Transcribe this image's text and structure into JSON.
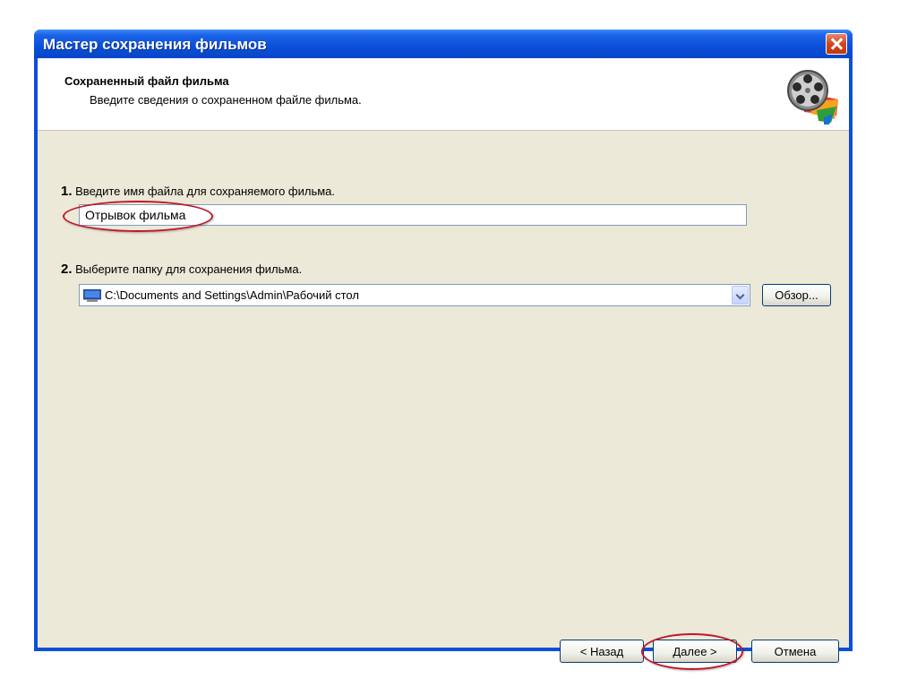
{
  "window": {
    "title": "Мастер сохранения фильмов"
  },
  "header": {
    "title": "Сохраненный файл фильма",
    "subtitle": "Введите сведения о сохраненном файле фильма.",
    "icon": "film-reel-icon"
  },
  "step1": {
    "number": "1.",
    "label": "Введите имя файла для сохраняемого фильма.",
    "value": "Отрывок фильма"
  },
  "step2": {
    "number": "2.",
    "label": "Выберите папку для сохранения фильма.",
    "folder": "C:\\Documents and Settings\\Admin\\Рабочий стол",
    "folder_icon": "desktop-icon",
    "browse_label": "Обзор..."
  },
  "buttons": {
    "back": "< Назад",
    "next": "Далее >",
    "cancel": "Отмена"
  },
  "colors": {
    "titlebar": "#0a4fd8",
    "dialog_bg": "#ece9d8",
    "highlight": "#c0182a",
    "close": "#d2461f"
  }
}
